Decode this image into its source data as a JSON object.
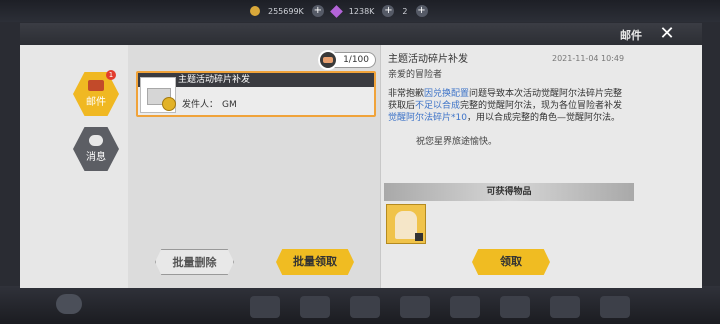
{
  "topbar": {
    "coin": "255699K",
    "gem": "1238K",
    "count": "2"
  },
  "panel": {
    "title": "邮件"
  },
  "nav": [
    {
      "label": "邮件",
      "badge": "1"
    },
    {
      "label": "消息"
    }
  ],
  "counter": "1/100",
  "mail_item": {
    "title": "主题活动碎片补发",
    "sender_label": "发件人：",
    "sender": "GM"
  },
  "detail": {
    "title": "主题活动碎片补发",
    "date": "2021-11-04 10:49",
    "greeting": "亲爱的冒险者",
    "body": [
      {
        "text": "非常抱歉",
        "blue": false
      },
      {
        "text": "因兑换配置",
        "blue": true
      },
      {
        "text": "问题导致本次活动觉醒阿尔法碎片完整获取后",
        "blue": false
      },
      {
        "text": "不足以合成",
        "blue": true
      },
      {
        "text": "完整的觉醒阿尔法，现为各位冒险者补发",
        "blue": false
      },
      {
        "text": "觉醒阿尔法碎片*10",
        "blue": true
      },
      {
        "text": "，用以合成完整的角色—觉醒阿尔法。",
        "blue": false
      }
    ],
    "sign": "祝您星界旅途愉快。",
    "items_header": "可获得物品"
  },
  "buttons": {
    "delete": "批量删除",
    "claim_all": "批量领取",
    "claim": "领取"
  }
}
